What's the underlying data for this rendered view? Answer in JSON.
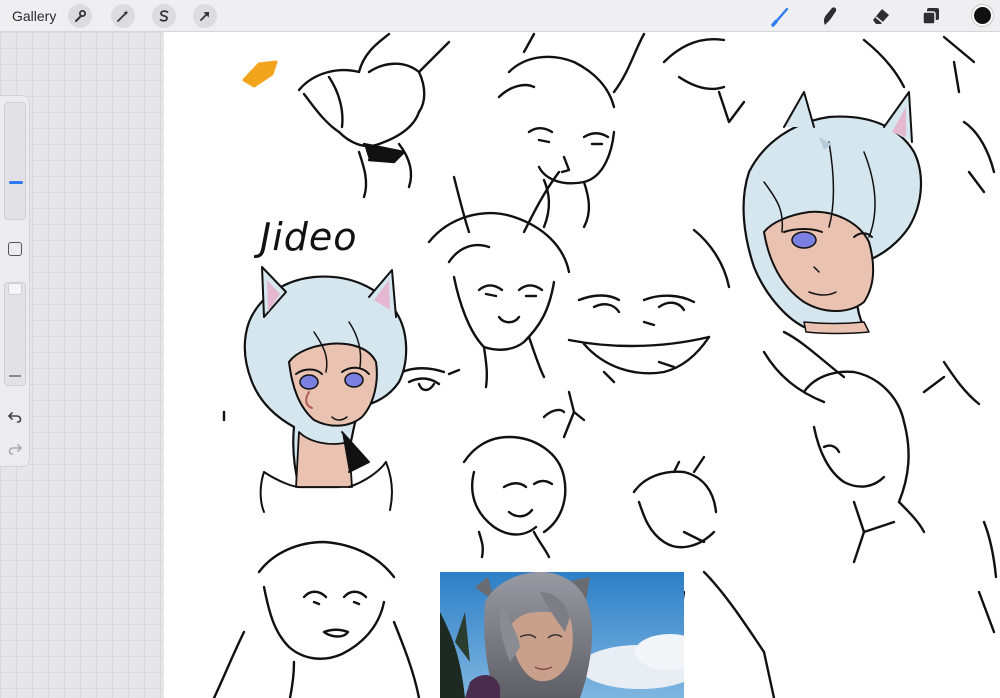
{
  "toolbar": {
    "gallery_label": "Gallery",
    "left_tools": [
      {
        "name": "actions",
        "icon": "wrench-icon"
      },
      {
        "name": "adjustments",
        "icon": "magic-wand-icon"
      },
      {
        "name": "selection",
        "icon": "selection-s-icon"
      },
      {
        "name": "transform",
        "icon": "arrow-cursor-icon"
      }
    ],
    "right_tools": [
      {
        "name": "brush",
        "icon": "brush-icon",
        "active": true
      },
      {
        "name": "smudge",
        "icon": "smudge-icon"
      },
      {
        "name": "eraser",
        "icon": "eraser-icon"
      },
      {
        "name": "layers",
        "icon": "layers-icon"
      }
    ],
    "current_color": "#111111",
    "accent_color": "#2f7bf0"
  },
  "sidebar": {
    "brush_size_level": 0.29,
    "brush_opacity_level": 1.0,
    "modifier_icon": "square-modifier-icon",
    "undo_icon": "undo-icon",
    "redo_icon": "redo-icon"
  },
  "canvas": {
    "handwritten_label": "Jideo",
    "swatch_color": "#f2a41c",
    "hair_color": "#d6e6ef",
    "skin_color": "#e9c2b1",
    "eye_color": "#7b7fe0"
  }
}
